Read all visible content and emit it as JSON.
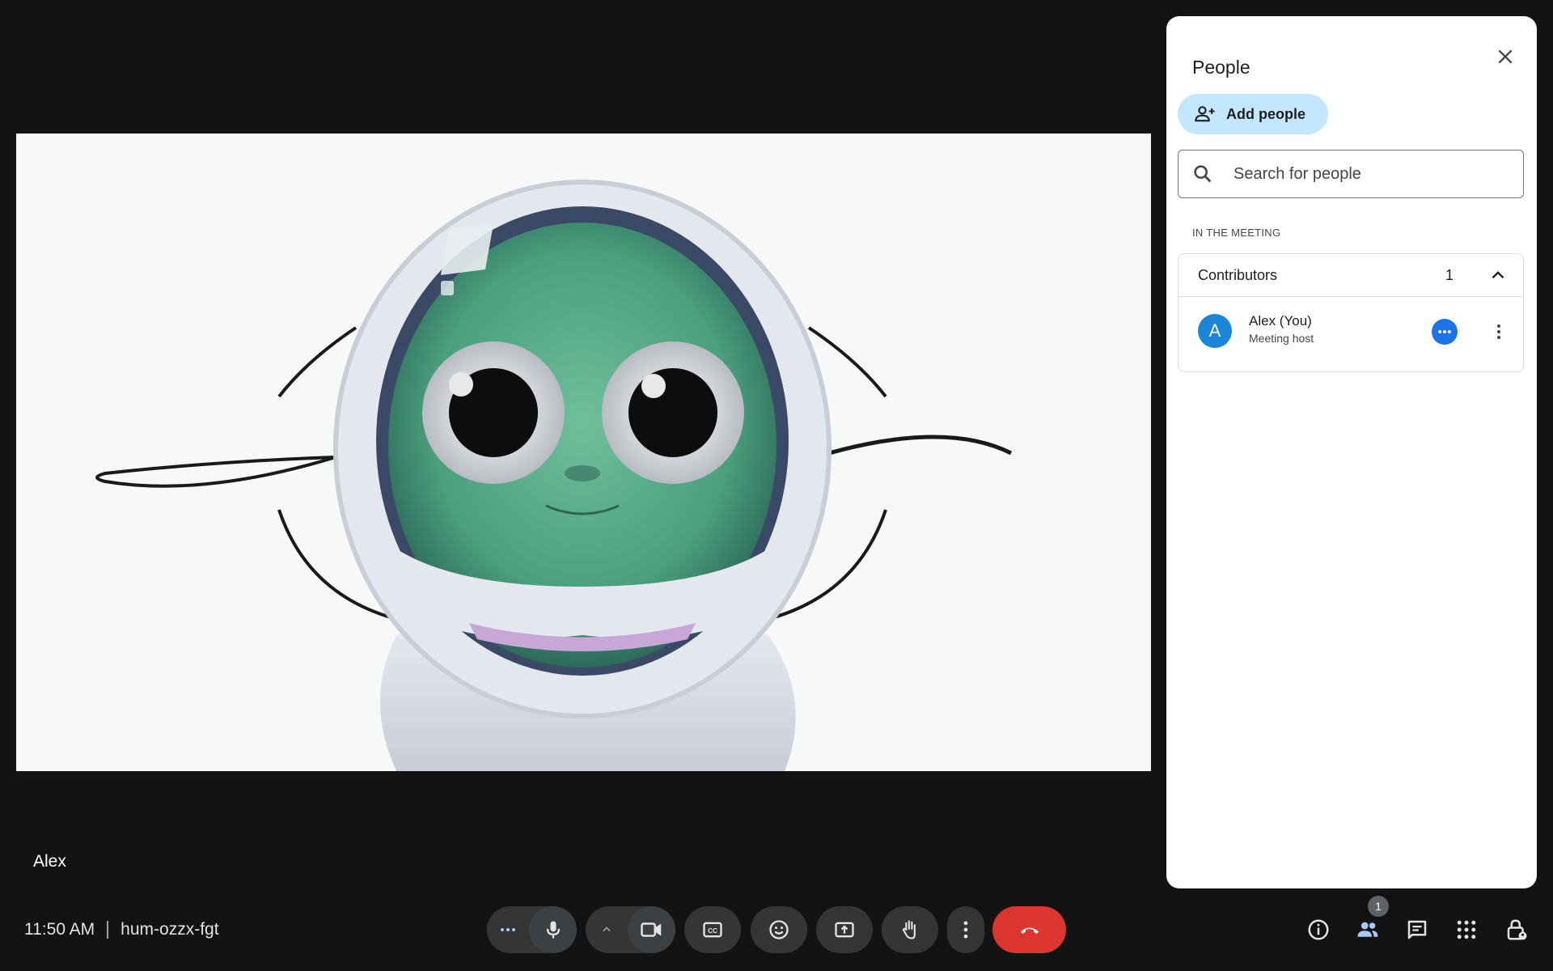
{
  "stage": {
    "participant_name": "Alex",
    "background_color": "#f8f8f9"
  },
  "bottom_bar": {
    "time": "11:50 AM",
    "meeting_code": "hum-ozzx-fgt",
    "controls": [
      {
        "name": "more-reactions-button",
        "icon": "dots-horizontal-icon"
      },
      {
        "name": "microphone-button",
        "icon": "microphone-icon"
      },
      {
        "name": "camera-options-button",
        "icon": "chevron-up-icon"
      },
      {
        "name": "camera-button",
        "icon": "video-camera-icon"
      },
      {
        "name": "captions-button",
        "icon": "closed-captions-icon"
      },
      {
        "name": "emoji-button",
        "icon": "emoji-icon"
      },
      {
        "name": "present-button",
        "icon": "present-screen-icon"
      },
      {
        "name": "raise-hand-button",
        "icon": "hand-icon"
      },
      {
        "name": "more-options-button",
        "icon": "kebab-icon"
      },
      {
        "name": "leave-call-button",
        "icon": "hang-up-icon",
        "color": "#dc362e"
      }
    ],
    "right_icons": [
      "info-icon",
      "people-icon",
      "chat-icon",
      "apps-grid-icon",
      "host-controls-lock-icon"
    ],
    "people_badge": "1"
  },
  "panel": {
    "title": "People",
    "add_people_label": "Add people",
    "search_placeholder": "Search for people",
    "section_label": "IN THE MEETING",
    "group": {
      "label": "Contributors",
      "count": "1",
      "expanded": true
    },
    "participants": [
      {
        "initial": "A",
        "name": "Alex (You)",
        "role": "Meeting host",
        "avatar_color": "#1b86d7"
      }
    ]
  },
  "colors": {
    "background": "#131314",
    "control": "#333537",
    "accent": "#1a73e8",
    "add_people_bg": "#c2e7ff",
    "hang_up": "#dc362e"
  }
}
